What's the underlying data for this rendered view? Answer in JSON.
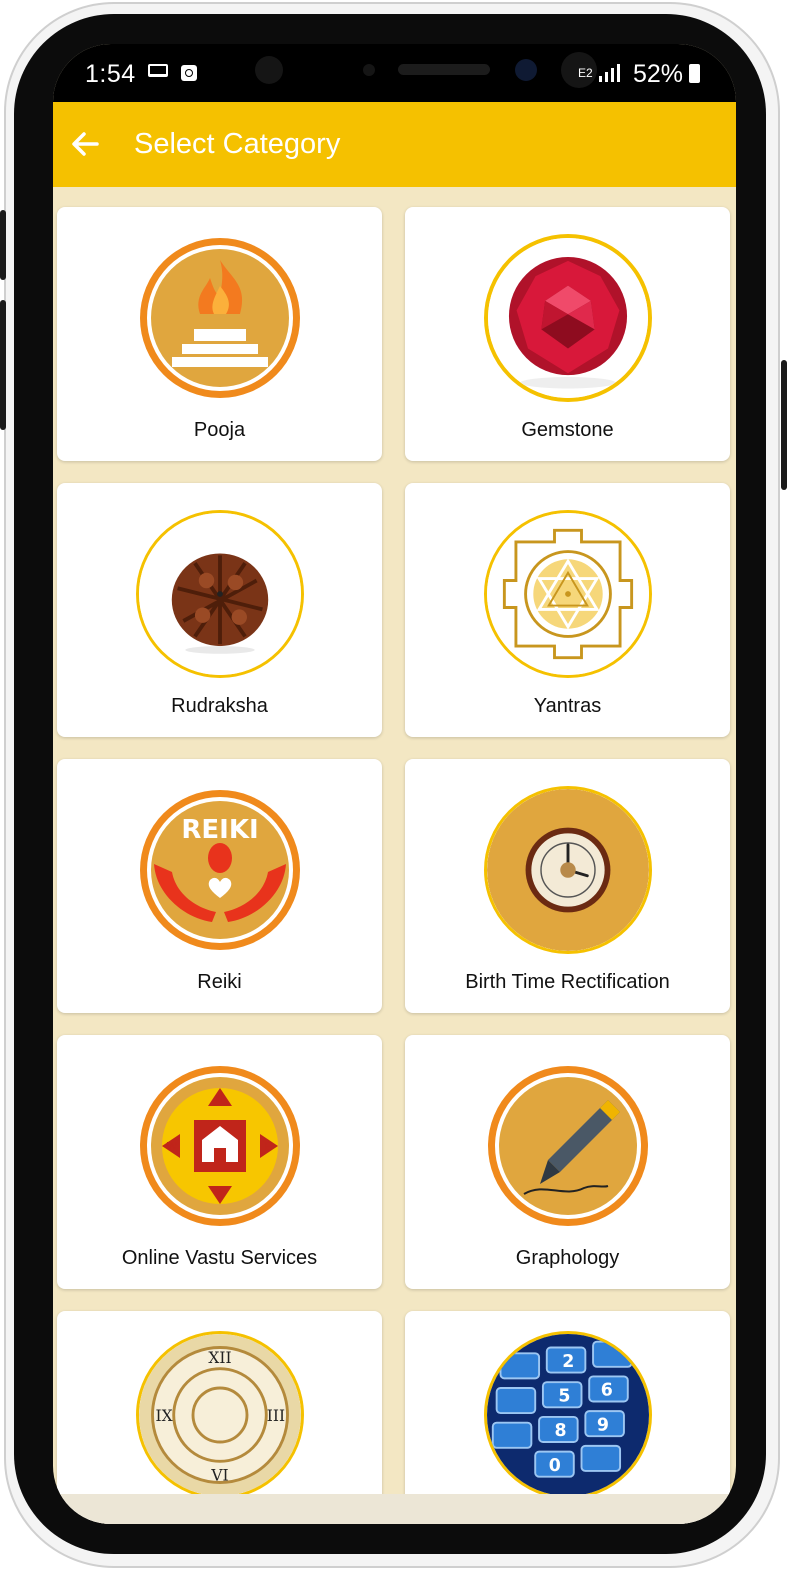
{
  "status_bar": {
    "time": "1:54",
    "battery_percent": "52%",
    "network": "E2"
  },
  "header": {
    "title": "Select Category"
  },
  "categories": [
    {
      "label": "Pooja",
      "icon": "fire-altar-icon"
    },
    {
      "label": "Gemstone",
      "icon": "gemstone-icon"
    },
    {
      "label": "Rudraksha",
      "icon": "rudraksha-bead-icon"
    },
    {
      "label": "Yantras",
      "icon": "sri-yantra-icon"
    },
    {
      "label": "Reiki",
      "icon": "reiki-hands-icon"
    },
    {
      "label": "Birth Time Rectification",
      "icon": "astro-clock-icon"
    },
    {
      "label": "Online Vastu Services",
      "icon": "vastu-compass-icon"
    },
    {
      "label": "Graphology",
      "icon": "fountain-pen-icon"
    },
    {
      "label": "",
      "icon": "roman-clock-icon"
    },
    {
      "label": "",
      "icon": "keypad-icon"
    }
  ],
  "colors": {
    "accent": "#f5c100",
    "icon_orange": "#f08a1c",
    "icon_tan": "#e0a63e",
    "background": "#f3e7c3"
  }
}
